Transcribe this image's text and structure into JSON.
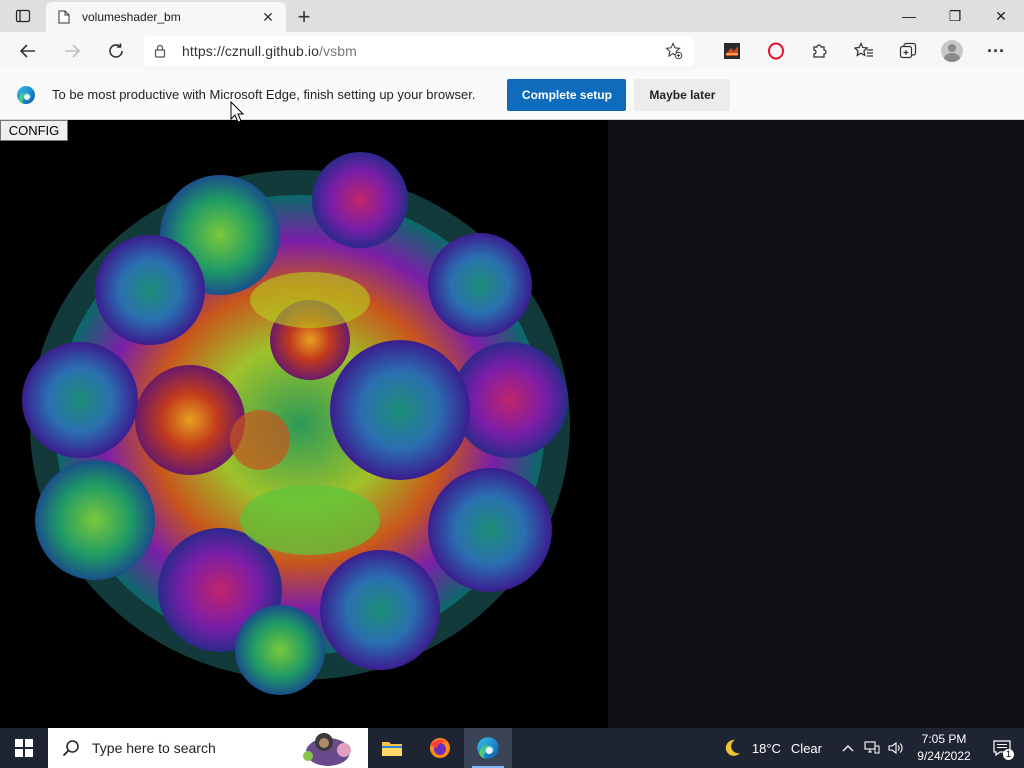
{
  "browser": {
    "tab": {
      "title": "volumeshader_bm",
      "close_glyph": "✕"
    },
    "new_tab_glyph": "+",
    "window_controls": {
      "minimize": "—",
      "maximize": "❒",
      "close": "✕"
    },
    "address": {
      "host": "https://cznull.github.io",
      "path": "/vsbm"
    },
    "extensions": [
      "game-extension-icon",
      "opera-ring-icon",
      "puzzle-extensions-icon"
    ],
    "toolbar_icons": [
      "favorites-icon",
      "collections-icon",
      "profile-avatar",
      "more-menu-icon"
    ],
    "more_glyph": "···"
  },
  "infobar": {
    "message": "To be most productive with Microsoft Edge, finish setting up your browser.",
    "primary_button": "Complete setup",
    "secondary_button": "Maybe later"
  },
  "page": {
    "config_button": "CONFIG"
  },
  "taskbar": {
    "search_placeholder": "Type here to search",
    "apps": [
      "file-explorer-icon",
      "firefox-icon",
      "edge-icon"
    ],
    "weather": {
      "temp": "18°C",
      "condition": "Clear"
    },
    "clock": {
      "time": "7:05 PM",
      "date": "9/24/2022"
    },
    "notification_count": "1"
  },
  "colors": {
    "accent": "#0f6cbd",
    "taskbar": "#1f2433",
    "page_bg": "#000000",
    "right_panel": "#110f16"
  }
}
